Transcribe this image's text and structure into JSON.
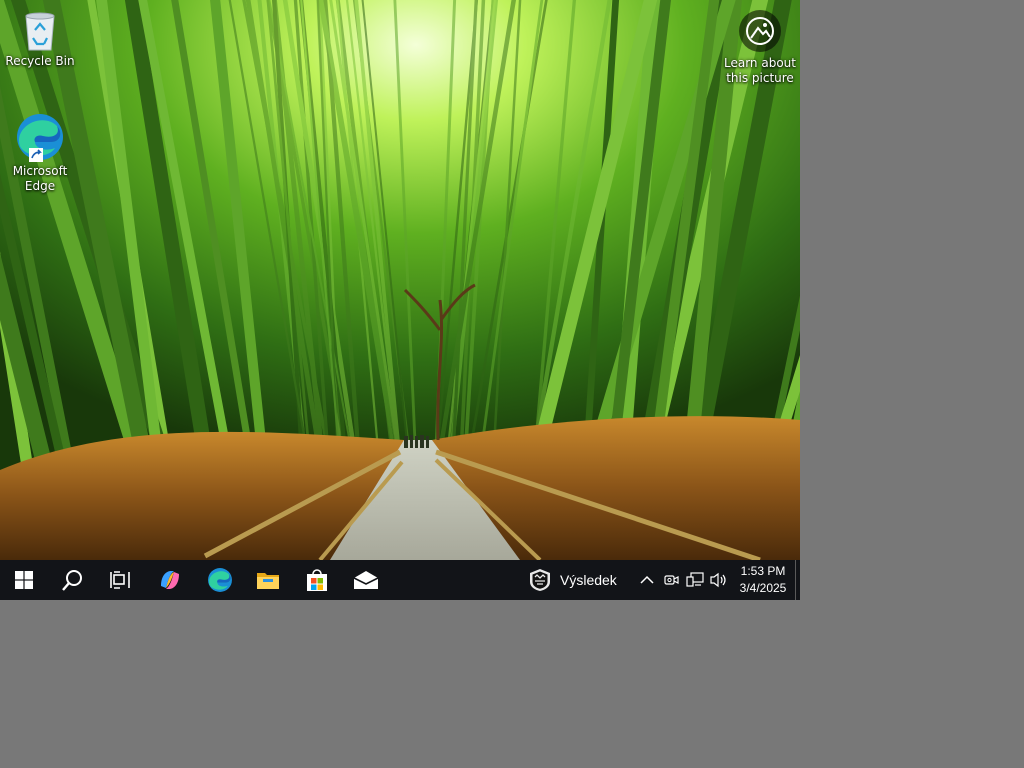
{
  "desktop": {
    "icons": [
      {
        "label": "Recycle Bin",
        "icon": "recycle-bin-icon"
      },
      {
        "label": "Microsoft Edge",
        "icon": "edge-icon"
      }
    ],
    "learn_picture": {
      "label": "Learn about this picture",
      "icon": "camera-icon"
    }
  },
  "taskbar": {
    "start": {
      "icon": "windows-logo-icon"
    },
    "search": {
      "icon": "search-icon"
    },
    "task_view": {
      "icon": "task-view-icon"
    },
    "pinned": [
      {
        "name": "copilot",
        "icon": "copilot-icon"
      },
      {
        "name": "edge",
        "icon": "edge-icon"
      },
      {
        "name": "file-explorer",
        "icon": "folder-icon"
      },
      {
        "name": "microsoft-store",
        "icon": "store-icon"
      },
      {
        "name": "mail",
        "icon": "mail-icon"
      }
    ],
    "weather": {
      "label": "Výsledek",
      "icon": "nhl-icon"
    },
    "tray": {
      "icons": [
        "chevron-up-icon",
        "meet-now-icon",
        "network-icon",
        "volume-icon"
      ],
      "time": "1:53 PM",
      "date": "3/4/2025"
    }
  },
  "colors": {
    "taskbar": "#121418",
    "outer_background": "#787878",
    "accent_edge": "#1fb0e6"
  }
}
